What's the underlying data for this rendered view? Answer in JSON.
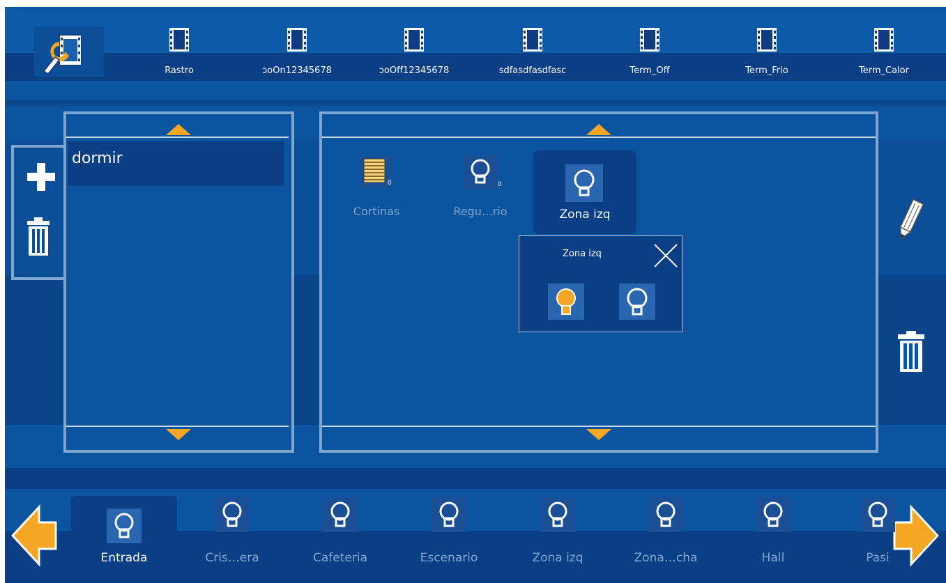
{
  "top_bar": {
    "items": [
      {
        "label": "Rastro"
      },
      {
        "label": "ↄoOn12345678"
      },
      {
        "label": "ↄoOff12345678"
      },
      {
        "label": "sdfasdfasdfasc"
      },
      {
        "label": "Term_Off"
      },
      {
        "label": "Term_Frio"
      },
      {
        "label": "Term_Calor"
      }
    ]
  },
  "scenes": {
    "items": [
      {
        "label": "dormir"
      }
    ]
  },
  "devices": {
    "items": [
      {
        "label": "Cortinas",
        "badge": "0"
      },
      {
        "label": "Regu…rio",
        "badge": "0"
      },
      {
        "label": "Zona izq"
      }
    ],
    "popup": {
      "title": "Zona izq"
    }
  },
  "bottom_bar": {
    "items": [
      {
        "label": "Entrada"
      },
      {
        "label": "Cris…era"
      },
      {
        "label": "Cafeteria"
      },
      {
        "label": "Escenario"
      },
      {
        "label": "Zona izq"
      },
      {
        "label": "Zona…cha"
      },
      {
        "label": "Hall"
      },
      {
        "label": "Pasi"
      }
    ]
  },
  "colors": {
    "accent": "#f5a623",
    "background": "#0b55a0",
    "dark": "#0d3d80",
    "frame": "#7fa6cf"
  }
}
